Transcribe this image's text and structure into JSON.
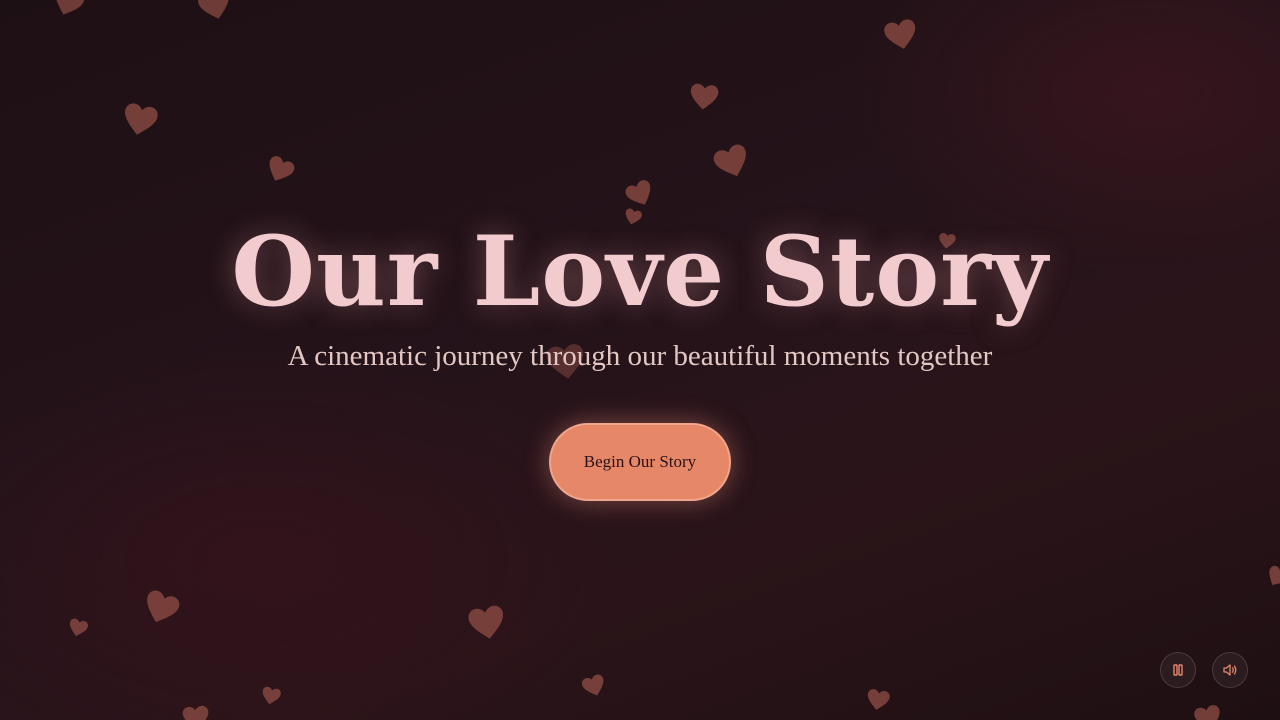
{
  "hero": {
    "title": "Our Love Story",
    "subtitle": "A cinematic journey through our beautiful moments together",
    "cta_label": "Begin Our Story"
  },
  "controls": {
    "pause_icon": "pause-icon",
    "sound_icon": "volume-icon"
  },
  "colors": {
    "background": "#221217",
    "title": "#f1cbcd",
    "subtitle": "#e3c7c2",
    "button": "#e68767",
    "hearts": "#8a4a42",
    "control_icon": "#e8866a"
  }
}
